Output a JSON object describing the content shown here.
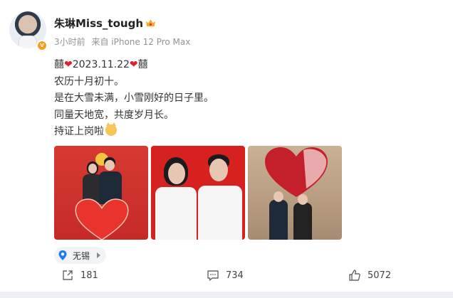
{
  "user": {
    "name": "朱琳Miss_tough",
    "badge_icon": "crown-icon",
    "verified_icon": "vip-badge-icon"
  },
  "meta": {
    "time": "3小时前",
    "source": "来自 iPhone 12 Pro Max"
  },
  "post": {
    "line1_left": "囍",
    "line1_date": "2023.11.22",
    "line1_right": "囍",
    "line2": "农历十月初十。",
    "line3": "是在大雪未满，小雪刚好的日子里。",
    "line4": "同量天地宽，共度岁月长。",
    "line5": "持证上岗啦"
  },
  "photos": [
    {
      "name": "photo-registration",
      "alt": "registration office photo"
    },
    {
      "name": "photo-id",
      "alt": "red background portrait"
    },
    {
      "name": "photo-balloons",
      "alt": "balloon heart photo"
    }
  ],
  "location": {
    "label": "无锡"
  },
  "actions": {
    "share_count": "181",
    "comment_count": "734",
    "like_count": "5072"
  },
  "colors": {
    "accent_red": "#e0202c",
    "location_blue": "#1a7cf5",
    "meta_gray": "#939393"
  }
}
